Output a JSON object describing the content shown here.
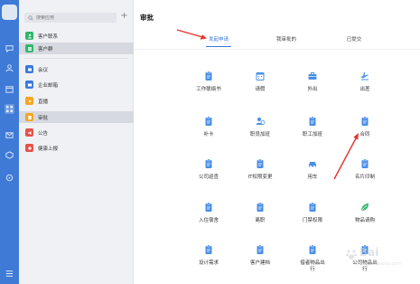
{
  "colors": {
    "rail": "#3e7ad6",
    "accent": "#3a78e0",
    "icon_blue": "#4a8fe8",
    "annotation": "#e5322d"
  },
  "rail": {
    "items": [
      "chat-icon",
      "contacts-icon",
      "calendar-icon",
      "workspace-icon",
      "mail-icon",
      "box-icon",
      "settings-icon",
      "menu-icon"
    ]
  },
  "sidebar": {
    "search_placeholder": "搜索应用",
    "add_label": "+",
    "items": [
      {
        "label": "客户联系",
        "icon": "customer-contact-icon",
        "color": "#2fb66b"
      },
      {
        "label": "客户群",
        "icon": "customer-group-icon",
        "color": "#2fb66b"
      },
      {
        "label": "会议",
        "icon": "meeting-icon",
        "color": "#3a78e0"
      },
      {
        "label": "企业邮箱",
        "icon": "mail-icon",
        "color": "#3a78e0"
      },
      {
        "label": "直播",
        "icon": "live-icon",
        "color": "#f5a623"
      },
      {
        "label": "审批",
        "icon": "approval-icon",
        "color": "#f5a623"
      },
      {
        "label": "公告",
        "icon": "announcement-icon",
        "color": "#e5534b"
      },
      {
        "label": "健康上报",
        "icon": "health-report-icon",
        "color": "#e5534b"
      }
    ]
  },
  "main": {
    "title": "审批",
    "tabs": [
      {
        "label": "发起申请",
        "active": true
      },
      {
        "label": "我审批的",
        "active": false
      },
      {
        "label": "已提交",
        "active": false
      }
    ],
    "tiles": [
      {
        "label": "工作联络书",
        "icon": "clipboard-icon"
      },
      {
        "label": "请假",
        "icon": "calendar-icon"
      },
      {
        "label": "外出",
        "icon": "briefcase-icon"
      },
      {
        "label": "出差",
        "icon": "airplane-icon"
      },
      {
        "label": "补卡",
        "icon": "clipboard-icon"
      },
      {
        "label": "职员加班",
        "icon": "person-clock-icon"
      },
      {
        "label": "职工加班",
        "icon": "clipboard-icon"
      },
      {
        "label": "合同",
        "icon": "clipboard-icon"
      },
      {
        "label": "公司巡查",
        "icon": "clipboard-icon"
      },
      {
        "label": "IT权限变更",
        "icon": "clipboard-icon"
      },
      {
        "label": "用车",
        "icon": "car-icon"
      },
      {
        "label": "名片印制",
        "icon": "clipboard-icon"
      },
      {
        "label": "入住宿舍",
        "icon": "clipboard-icon"
      },
      {
        "label": "离职",
        "icon": "clipboard-icon"
      },
      {
        "label": "门禁权限",
        "icon": "clipboard-icon"
      },
      {
        "label": "物品请购",
        "icon": "leaf-icon"
      },
      {
        "label": "设计需求",
        "icon": "clipboard-icon"
      },
      {
        "label": "客户建档",
        "icon": "clipboard-icon"
      },
      {
        "label": "借者物品出|行",
        "icon": "clipboard-icon"
      },
      {
        "label": "公司物品出|行",
        "icon": "clipboard-icon"
      }
    ]
  },
  "watermark": {
    "text": "Bai",
    "sub": "jingyan.baidu.com"
  }
}
